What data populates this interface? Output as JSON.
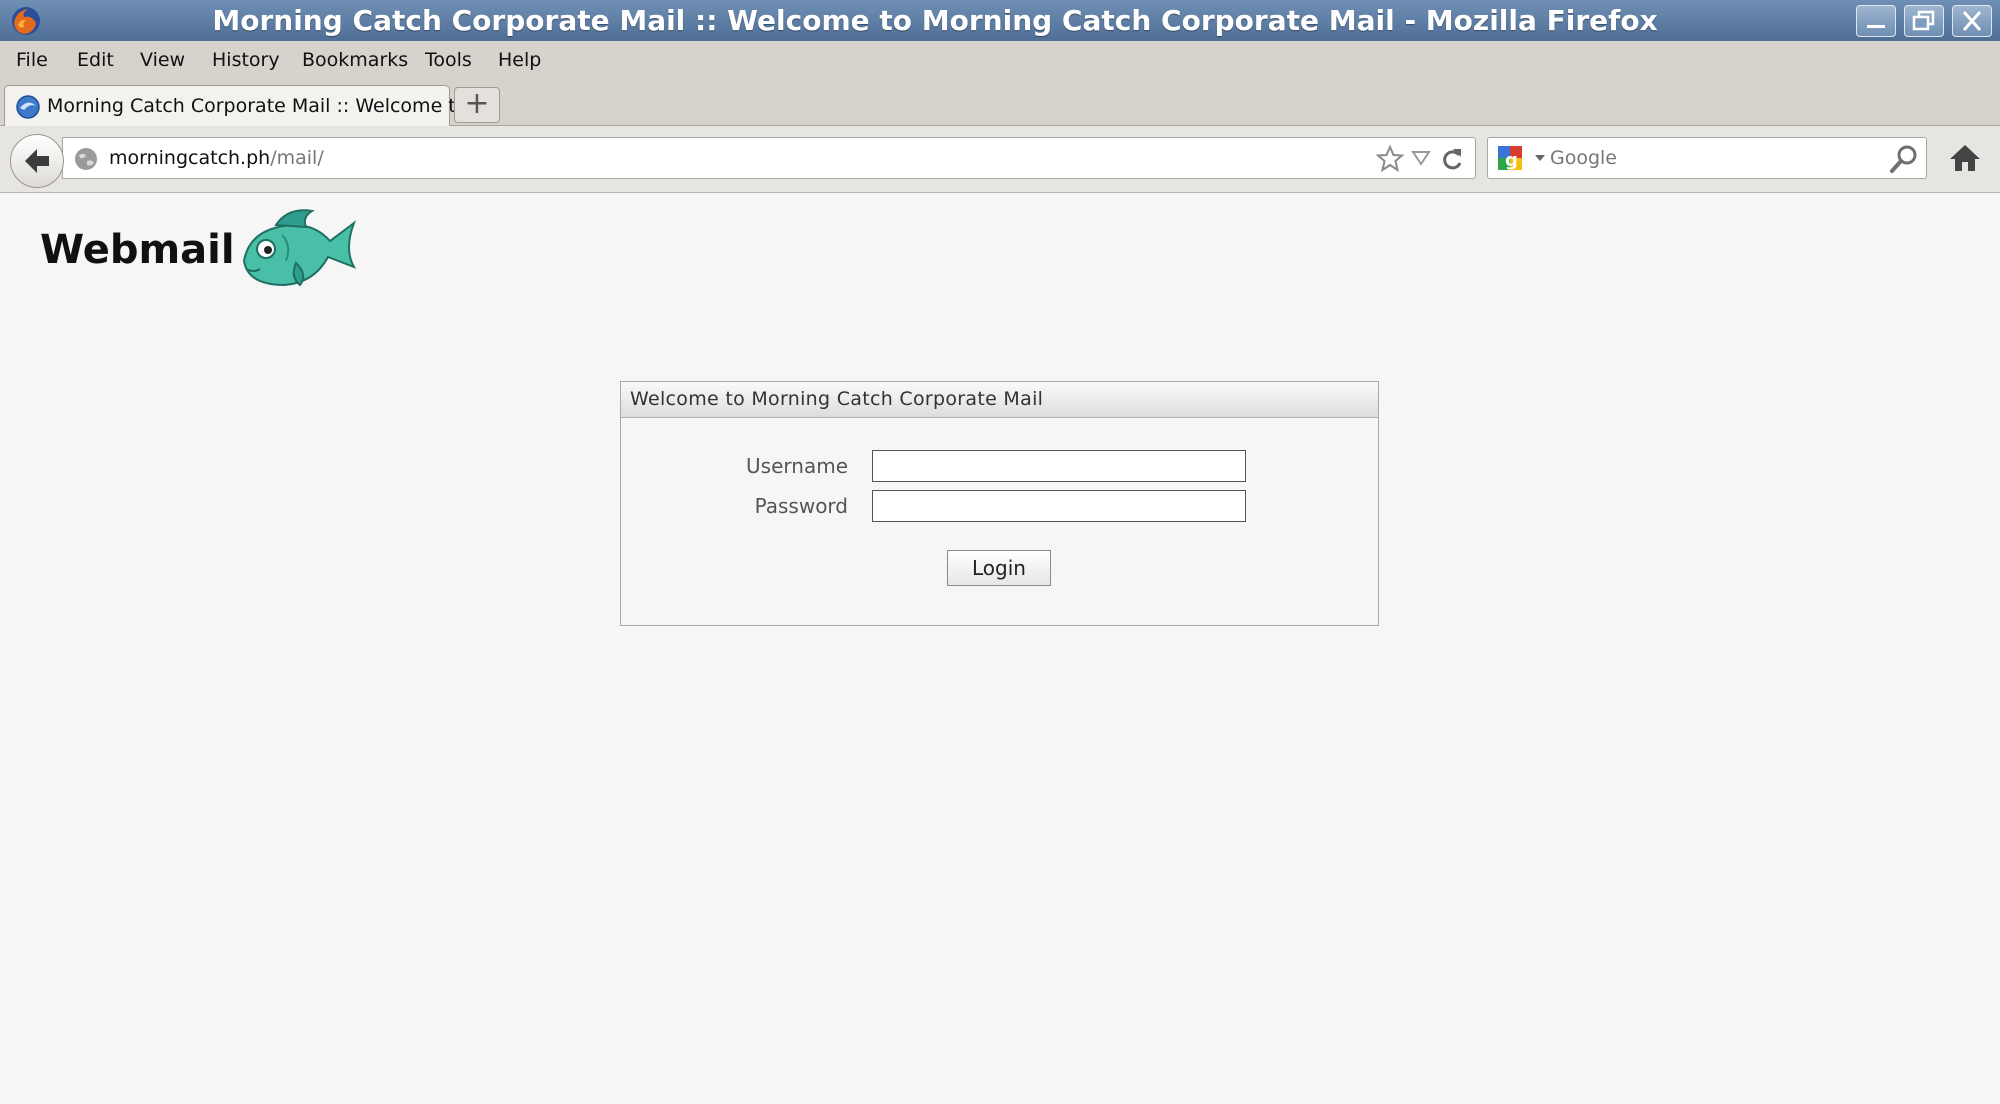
{
  "window": {
    "title": "Morning Catch Corporate Mail :: Welcome to Morning Catch Corporate Mail - Mozilla Firefox"
  },
  "menu": [
    "File",
    "Edit",
    "View",
    "History",
    "Bookmarks",
    "Tools",
    "Help"
  ],
  "tab": {
    "label": "Morning Catch Corporate Mail :: Welcome t...",
    "new_tab": "+"
  },
  "address": {
    "host": "morningcatch.ph",
    "path": "/mail/"
  },
  "search": {
    "placeholder": "Google"
  },
  "page": {
    "logo": "Webmail",
    "login": {
      "heading": "Welcome to Morning Catch Corporate Mail",
      "username_label": "Username",
      "username_value": "",
      "password_label": "Password",
      "password_value": "",
      "submit": "Login"
    }
  },
  "colors": {
    "titlebar": "#5f7fa6",
    "chrome": "#d6d3cd",
    "page_bg": "#f6f6f6"
  },
  "icons": [
    "firefox-icon",
    "minimize-icon",
    "restore-icon",
    "close-icon",
    "back-arrow-icon",
    "globe-icon",
    "bookmark-star-icon",
    "dropdown-icon",
    "reload-icon",
    "google-icon",
    "magnifier-icon",
    "home-icon",
    "fish-logo-icon"
  ]
}
